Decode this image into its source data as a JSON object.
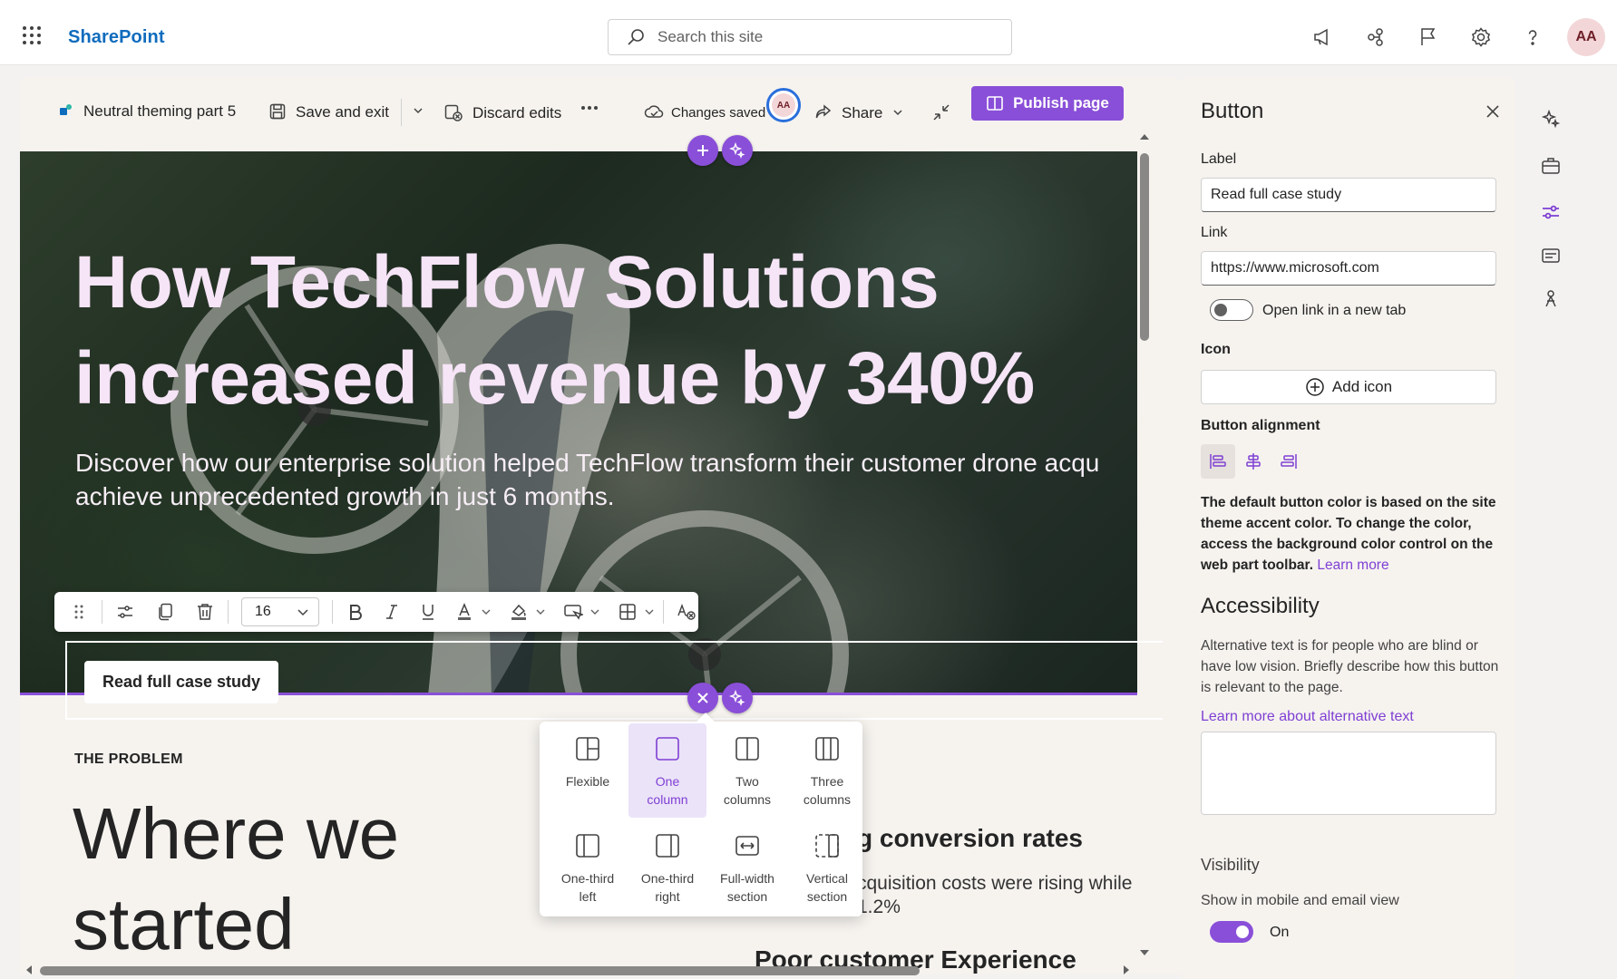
{
  "suite": {
    "brand": "SharePoint",
    "search_placeholder": "Search this site",
    "avatar_initials": "AA"
  },
  "commandbar": {
    "page_name": "Neutral theming part 5",
    "save_exit": "Save and exit",
    "discard": "Discard edits",
    "changes_saved": "Changes saved",
    "coauthor_initials": "AA",
    "share": "Share",
    "publish": "Publish page"
  },
  "hero": {
    "title_line1": "How TechFlow Solutions",
    "title_line2": "increased revenue by 340%",
    "desc_line1": "Discover how our enterprise solution helped TechFlow transform their customer drone acqu",
    "desc_line2": "achieve unprecedented growth in just 6 months.",
    "button_label": "Read full case study"
  },
  "text_toolbar": {
    "font_size": "16"
  },
  "body": {
    "section_label": "THE PROBLEM",
    "heading_line1": "Where we",
    "heading_line2": "started",
    "col2_heading": "g conversion rates",
    "col2_text1": "cquisition costs were rising while",
    "col2_text2": "1.2%",
    "col2_text2_prefix": "p",
    "col2_heading2": "Poor customer Experience"
  },
  "layout_options": [
    {
      "line1": "Flexible",
      "line2": ""
    },
    {
      "line1": "One",
      "line2": "column"
    },
    {
      "line1": "Two",
      "line2": "columns"
    },
    {
      "line1": "Three",
      "line2": "columns"
    },
    {
      "line1": "One-third",
      "line2": "left"
    },
    {
      "line1": "One-third",
      "line2": "right"
    },
    {
      "line1": "Full-width",
      "line2": "section"
    },
    {
      "line1": "Vertical",
      "line2": "section"
    }
  ],
  "pane": {
    "title": "Button",
    "label_label": "Label",
    "label_value": "Read full case study",
    "link_label": "Link",
    "link_value": "https://www.microsoft.com",
    "new_tab_label": "Open link in a new tab",
    "icon_label": "Icon",
    "add_icon": "Add icon",
    "alignment_label": "Button alignment",
    "note": "The default button color is based on the site theme accent color. To change the color, access the background color control on the web part toolbar.",
    "note_link": "Learn more",
    "accessibility_heading": "Accessibility",
    "accessibility_desc": "Alternative text is for people who are blind or have low vision. Briefly describe how this button is relevant to the page.",
    "alt_link": "Learn more about alternative text",
    "visibility_label": "Visibility",
    "mobile_label": "Show in mobile and email view",
    "mobile_state": "On"
  },
  "colors": {
    "accent": "#8a4fd8",
    "brand_blue": "#0f6cbd"
  }
}
